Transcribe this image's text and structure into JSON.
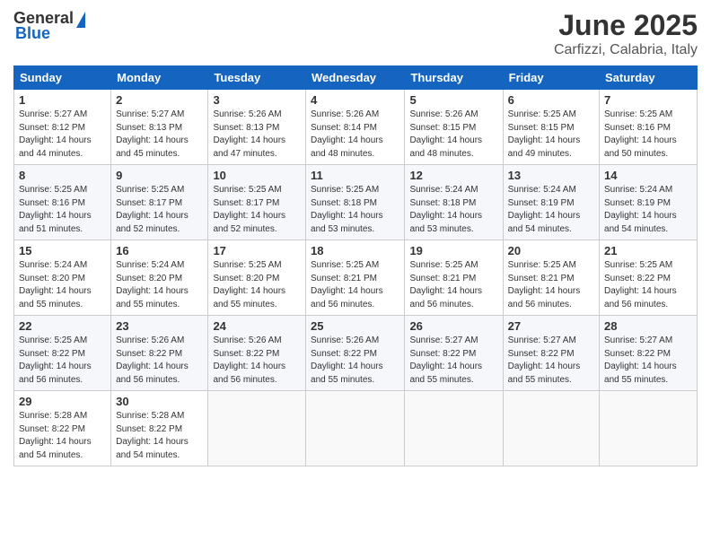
{
  "header": {
    "logo_general": "General",
    "logo_blue": "Blue",
    "month_year": "June 2025",
    "location": "Carfizzi, Calabria, Italy"
  },
  "weekdays": [
    "Sunday",
    "Monday",
    "Tuesday",
    "Wednesday",
    "Thursday",
    "Friday",
    "Saturday"
  ],
  "weeks": [
    [
      {
        "day": "1",
        "info": "Sunrise: 5:27 AM\nSunset: 8:12 PM\nDaylight: 14 hours\nand 44 minutes."
      },
      {
        "day": "2",
        "info": "Sunrise: 5:27 AM\nSunset: 8:13 PM\nDaylight: 14 hours\nand 45 minutes."
      },
      {
        "day": "3",
        "info": "Sunrise: 5:26 AM\nSunset: 8:13 PM\nDaylight: 14 hours\nand 47 minutes."
      },
      {
        "day": "4",
        "info": "Sunrise: 5:26 AM\nSunset: 8:14 PM\nDaylight: 14 hours\nand 48 minutes."
      },
      {
        "day": "5",
        "info": "Sunrise: 5:26 AM\nSunset: 8:15 PM\nDaylight: 14 hours\nand 48 minutes."
      },
      {
        "day": "6",
        "info": "Sunrise: 5:25 AM\nSunset: 8:15 PM\nDaylight: 14 hours\nand 49 minutes."
      },
      {
        "day": "7",
        "info": "Sunrise: 5:25 AM\nSunset: 8:16 PM\nDaylight: 14 hours\nand 50 minutes."
      }
    ],
    [
      {
        "day": "8",
        "info": "Sunrise: 5:25 AM\nSunset: 8:16 PM\nDaylight: 14 hours\nand 51 minutes."
      },
      {
        "day": "9",
        "info": "Sunrise: 5:25 AM\nSunset: 8:17 PM\nDaylight: 14 hours\nand 52 minutes."
      },
      {
        "day": "10",
        "info": "Sunrise: 5:25 AM\nSunset: 8:17 PM\nDaylight: 14 hours\nand 52 minutes."
      },
      {
        "day": "11",
        "info": "Sunrise: 5:25 AM\nSunset: 8:18 PM\nDaylight: 14 hours\nand 53 minutes."
      },
      {
        "day": "12",
        "info": "Sunrise: 5:24 AM\nSunset: 8:18 PM\nDaylight: 14 hours\nand 53 minutes."
      },
      {
        "day": "13",
        "info": "Sunrise: 5:24 AM\nSunset: 8:19 PM\nDaylight: 14 hours\nand 54 minutes."
      },
      {
        "day": "14",
        "info": "Sunrise: 5:24 AM\nSunset: 8:19 PM\nDaylight: 14 hours\nand 54 minutes."
      }
    ],
    [
      {
        "day": "15",
        "info": "Sunrise: 5:24 AM\nSunset: 8:20 PM\nDaylight: 14 hours\nand 55 minutes."
      },
      {
        "day": "16",
        "info": "Sunrise: 5:24 AM\nSunset: 8:20 PM\nDaylight: 14 hours\nand 55 minutes."
      },
      {
        "day": "17",
        "info": "Sunrise: 5:25 AM\nSunset: 8:20 PM\nDaylight: 14 hours\nand 55 minutes."
      },
      {
        "day": "18",
        "info": "Sunrise: 5:25 AM\nSunset: 8:21 PM\nDaylight: 14 hours\nand 56 minutes."
      },
      {
        "day": "19",
        "info": "Sunrise: 5:25 AM\nSunset: 8:21 PM\nDaylight: 14 hours\nand 56 minutes."
      },
      {
        "day": "20",
        "info": "Sunrise: 5:25 AM\nSunset: 8:21 PM\nDaylight: 14 hours\nand 56 minutes."
      },
      {
        "day": "21",
        "info": "Sunrise: 5:25 AM\nSunset: 8:22 PM\nDaylight: 14 hours\nand 56 minutes."
      }
    ],
    [
      {
        "day": "22",
        "info": "Sunrise: 5:25 AM\nSunset: 8:22 PM\nDaylight: 14 hours\nand 56 minutes."
      },
      {
        "day": "23",
        "info": "Sunrise: 5:26 AM\nSunset: 8:22 PM\nDaylight: 14 hours\nand 56 minutes."
      },
      {
        "day": "24",
        "info": "Sunrise: 5:26 AM\nSunset: 8:22 PM\nDaylight: 14 hours\nand 56 minutes."
      },
      {
        "day": "25",
        "info": "Sunrise: 5:26 AM\nSunset: 8:22 PM\nDaylight: 14 hours\nand 55 minutes."
      },
      {
        "day": "26",
        "info": "Sunrise: 5:27 AM\nSunset: 8:22 PM\nDaylight: 14 hours\nand 55 minutes."
      },
      {
        "day": "27",
        "info": "Sunrise: 5:27 AM\nSunset: 8:22 PM\nDaylight: 14 hours\nand 55 minutes."
      },
      {
        "day": "28",
        "info": "Sunrise: 5:27 AM\nSunset: 8:22 PM\nDaylight: 14 hours\nand 55 minutes."
      }
    ],
    [
      {
        "day": "29",
        "info": "Sunrise: 5:28 AM\nSunset: 8:22 PM\nDaylight: 14 hours\nand 54 minutes."
      },
      {
        "day": "30",
        "info": "Sunrise: 5:28 AM\nSunset: 8:22 PM\nDaylight: 14 hours\nand 54 minutes."
      },
      {
        "day": "",
        "info": ""
      },
      {
        "day": "",
        "info": ""
      },
      {
        "day": "",
        "info": ""
      },
      {
        "day": "",
        "info": ""
      },
      {
        "day": "",
        "info": ""
      }
    ]
  ]
}
